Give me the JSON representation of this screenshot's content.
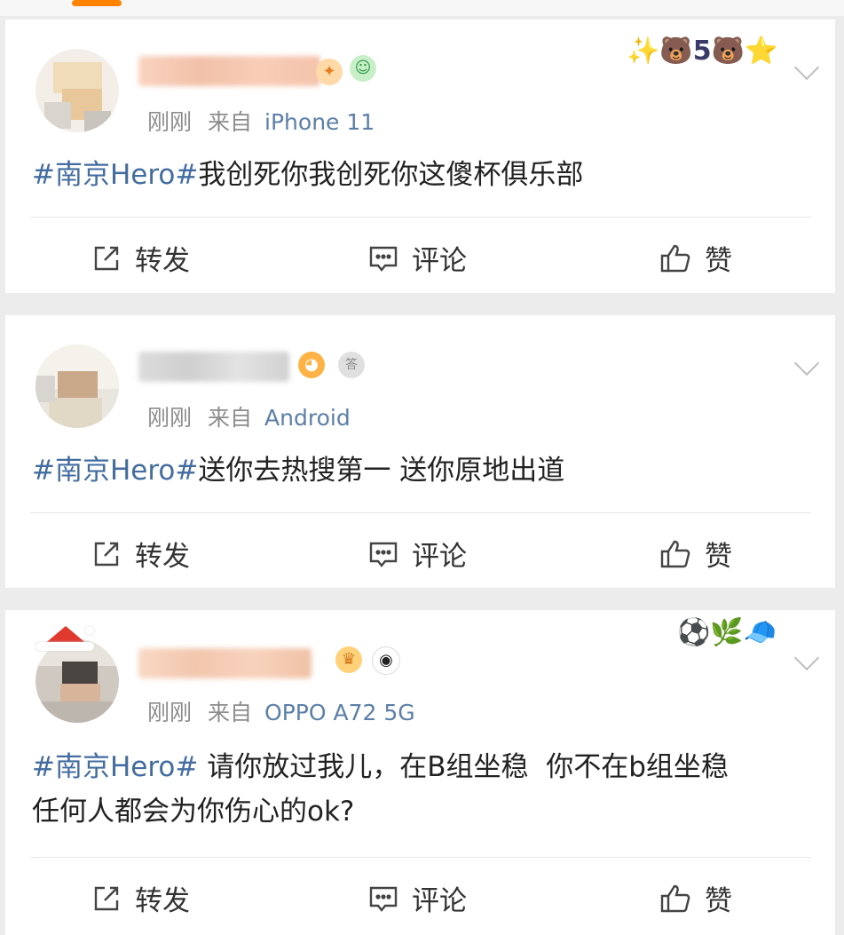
{
  "posts": [
    {
      "time": "刚刚",
      "source_prefix": "来自",
      "device": "iPhone 11",
      "hashtag": "#南京Hero#",
      "body": "我创死你我创死你这傻杯俱乐部",
      "body2": ""
    },
    {
      "time": "刚刚",
      "source_prefix": "来自",
      "device": "Android",
      "hashtag": "#南京Hero#",
      "body": "送你去热搜第一 送你原地出道",
      "body2": ""
    },
    {
      "time": "刚刚",
      "source_prefix": "来自",
      "device": "OPPO A72 5G",
      "hashtag": "#南京Hero#",
      "body": " 请你放过我儿，在B组坐稳  你不在b组坐稳",
      "body2": "任何人都会为你伤心的ok?"
    }
  ],
  "actions": {
    "repost": "转发",
    "comment": "评论",
    "like": "赞"
  },
  "colors": {
    "accent": "#ff8200",
    "hashtag": "#436da0",
    "meta": "#8c8c8c"
  },
  "icons": [
    "repost-icon",
    "comment-icon",
    "like-icon",
    "chevron-down-icon"
  ]
}
